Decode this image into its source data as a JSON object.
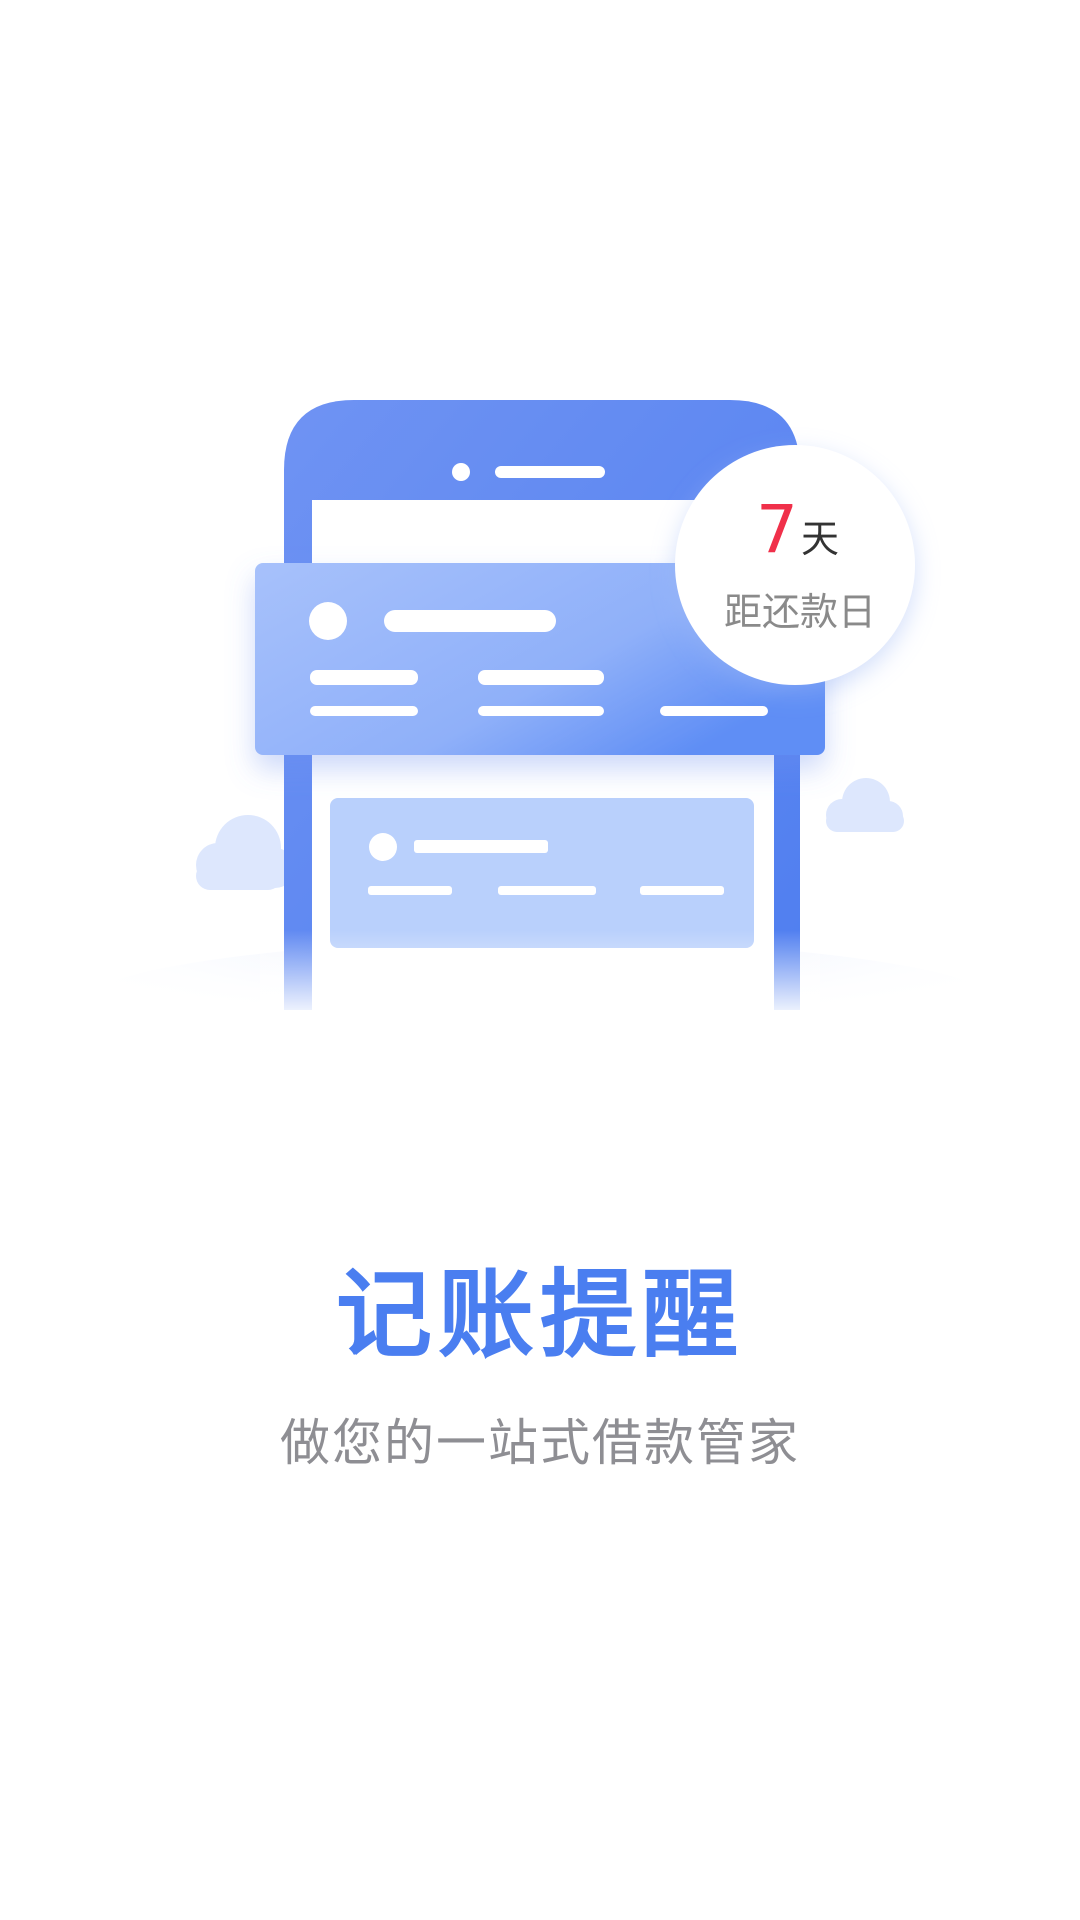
{
  "colors": {
    "accent": "#4a7ef0",
    "subtitle": "#8e8e93",
    "days_number": "#f0304a",
    "badge_text": "#8a8a8a"
  },
  "onboarding": {
    "title": "记账提醒",
    "subtitle": "做您的一站式借款管家"
  },
  "badge": {
    "number": "7",
    "unit": "天",
    "label": "距还款日"
  },
  "icons": [
    "phone-illustration",
    "cloud-icon",
    "avatar-placeholder"
  ]
}
